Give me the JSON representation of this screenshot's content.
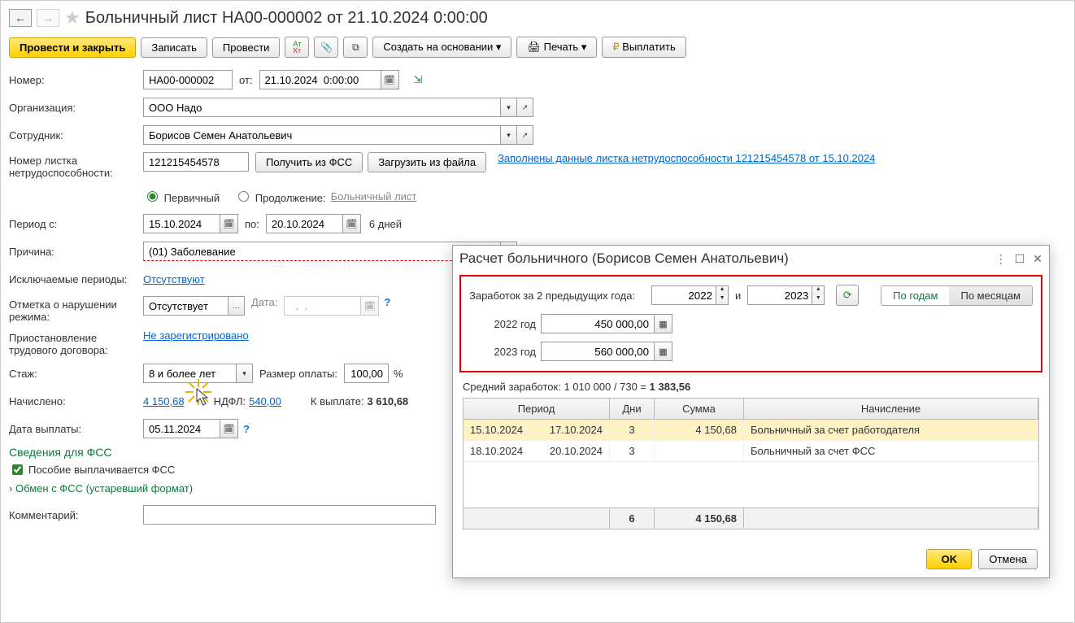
{
  "title": "Больничный лист НА00-000002 от 21.10.2024 0:00:00",
  "toolbar": {
    "postClose": "Провести и закрыть",
    "write": "Записать",
    "post": "Провести",
    "createOnBasis": "Создать на основании",
    "print": "Печать",
    "pay": "Выплатить"
  },
  "form": {
    "numberLabel": "Номер:",
    "number": "НА00-000002",
    "fromLabel": "от:",
    "date": "21.10.2024  0:00:00",
    "orgLabel": "Организация:",
    "org": "ООО Надо",
    "employeeLabel": "Сотрудник:",
    "employee": "Борисов Семен Анатольевич",
    "sickNumLabel": "Номер листка нетрудоспособности:",
    "sickNum": "121215454578",
    "getFromFss": "Получить из ФСС",
    "loadFromFile": "Загрузить из файла",
    "fssDataLink": "Заполнены данные листка нетрудоспособности 121215454578 от 15.10.2024",
    "primary": "Первичный",
    "continuation": "Продолжение:",
    "contLink": "Больничный лист",
    "periodFromLabel": "Период с:",
    "periodFrom": "15.10.2024",
    "periodToLabel": "по:",
    "periodTo": "20.10.2024",
    "days": "6 дней",
    "reasonLabel": "Причина:",
    "reason": "(01) Заболевание",
    "exclPeriodsLabel": "Исключаемые периоды:",
    "exclPeriods": "Отсутствуют",
    "violationLabel": "Отметка о нарушении режима:",
    "violation": "Отсутствует",
    "violationDateLabel": "Дата:",
    "violationDate": "  .  .    ",
    "suspendLabel": "Приостановление трудового договора:",
    "suspend": "Не зарегистрировано",
    "stazhLabel": "Стаж:",
    "stazh": "8 и более лет",
    "sizeLabel": "Размер оплаты:",
    "size": "100,00",
    "percent": "%",
    "accruedLabel": "Начислено:",
    "accrued": "4 150,68",
    "ndflLabel": "НДФЛ:",
    "ndfl": "540,00",
    "toPayLabel": "К выплате:",
    "toPay": "3 610,68",
    "payDateLabel": "Дата выплаты:",
    "payDate": "05.11.2024",
    "fssSection": "Сведения для ФСС",
    "fssPaid": "Пособие выплачивается ФСС",
    "fssExchange": "Обмен с ФСС (устаревший формат)",
    "commentLabel": "Комментарий:"
  },
  "panel": {
    "title": "Расчет больничного (Борисов Семен Анатольевич)",
    "earn2y": "Заработок за 2 предыдущих года:",
    "year1": "2022",
    "andLabel": "и",
    "year2": "2023",
    "byYears": "По годам",
    "byMonths": "По месяцам",
    "y1label": "2022 год",
    "y1value": "450 000,00",
    "y2label": "2023 год",
    "y2value": "560 000,00",
    "avgLabelPrefix": "Средний заработок: 1 010 000 / 730 = ",
    "avgValue": "1 383,56",
    "cols": {
      "period": "Период",
      "days": "Дни",
      "sum": "Сумма",
      "accr": "Начисление"
    },
    "rows": [
      {
        "from": "15.10.2024",
        "to": "17.10.2024",
        "days": "3",
        "sum": "4 150,68",
        "accr": "Больничный за счет работодателя"
      },
      {
        "from": "18.10.2024",
        "to": "20.10.2024",
        "days": "3",
        "sum": "",
        "accr": "Больничный за счет ФСС"
      }
    ],
    "foot": {
      "days": "6",
      "sum": "4 150,68"
    },
    "ok": "OK",
    "cancel": "Отмена"
  }
}
